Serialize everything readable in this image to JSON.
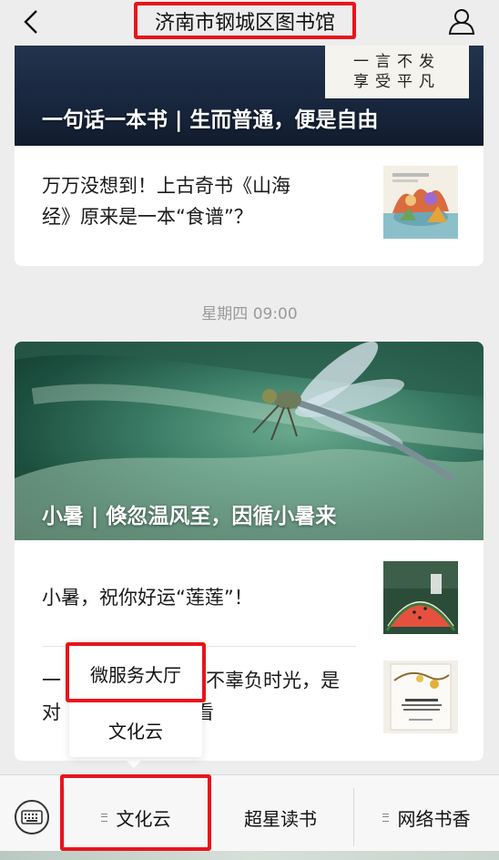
{
  "header": {
    "title": "济南市钢城区图书馆"
  },
  "articles_top": {
    "calligraphy_line1": "一言不发",
    "calligraphy_line2": "享受平凡",
    "hero_title": "一句话一本书 | 生而普通，便是自由",
    "item_title_line1": "万万没想到！上古奇书《山海",
    "item_title_line2": "经》原来是一本“食谱”？"
  },
  "date_label": "星期四 09:00",
  "articles_bottom": {
    "hero_title": "小暑 | 倏忽温风至，因循小暑来",
    "item1_title": "小暑，祝你好运“莲莲”！",
    "item2_line1_start": "一",
    "item2_line1_end": "不辜负时光，是",
    "item2_line2_start": "对",
    "item2_line2_end": "看"
  },
  "popup_menu": {
    "items": [
      "微服务大厅",
      "文化云"
    ]
  },
  "bottom_menu": {
    "tabs": [
      "文化云",
      "超星读书",
      "网络书香"
    ]
  }
}
